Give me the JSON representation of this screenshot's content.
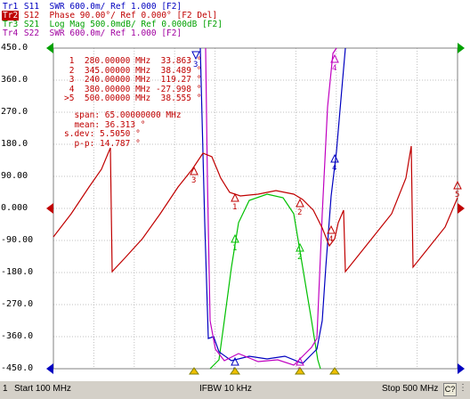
{
  "traces": [
    {
      "tag": "Tr1",
      "text": "S11  SWR 600.0m/ Ref 1.000 [F2]",
      "color": "#0000c0"
    },
    {
      "tag": "Tr2",
      "text": "S12  Phase 90.00°/ Ref 0.000° [F2 Del]",
      "color": "#c00000",
      "active": true
    },
    {
      "tag": "Tr3",
      "text": "S21  Log Mag 500.0mdB/ Ref 0.000dB [F2]",
      "color": "#00a000"
    },
    {
      "tag": "Tr4",
      "text": "S22  SWR 600.0m/ Ref 1.000 [F2]",
      "color": "#a000a0"
    }
  ],
  "y_labels": [
    "450.0",
    "360.0",
    "270.0",
    "180.0",
    "90.00",
    "0.000",
    "-90.00",
    "-180.0",
    "-270.0",
    "-360.0",
    "-450.0"
  ],
  "markers": [
    {
      "num": " 1",
      "freq": "280.00000 MHz",
      "val": " 33.863 °"
    },
    {
      "num": " 2",
      "freq": "345.00000 MHz",
      "val": " 38.489 °"
    },
    {
      "num": " 3",
      "freq": "240.00000 MHz",
      "val": " 119.27 °"
    },
    {
      "num": " 4",
      "freq": "380.00000 MHz",
      "val": "-27.998 °"
    },
    {
      "num": ">5",
      "freq": "500.00000 MHz",
      "val": " 38.555 °"
    }
  ],
  "stats": [
    {
      "label": "  span:",
      "val": " 65.00000000 MHz"
    },
    {
      "label": "  mean:",
      "val": " 36.313 °"
    },
    {
      "label": "s.dev:",
      "val": " 5.5050 °"
    },
    {
      "label": "  p-p:",
      "val": " 14.787 °"
    }
  ],
  "status": {
    "channel": "1",
    "start": "Start 100 MHz",
    "ifbw": "IFBW 10 kHz",
    "stop": "Stop 500 MHz",
    "c_btn": "C?"
  },
  "colors": {
    "s11": "#0000c0",
    "s12": "#c00000",
    "s21": "#00c000",
    "s22": "#c000c0"
  }
}
